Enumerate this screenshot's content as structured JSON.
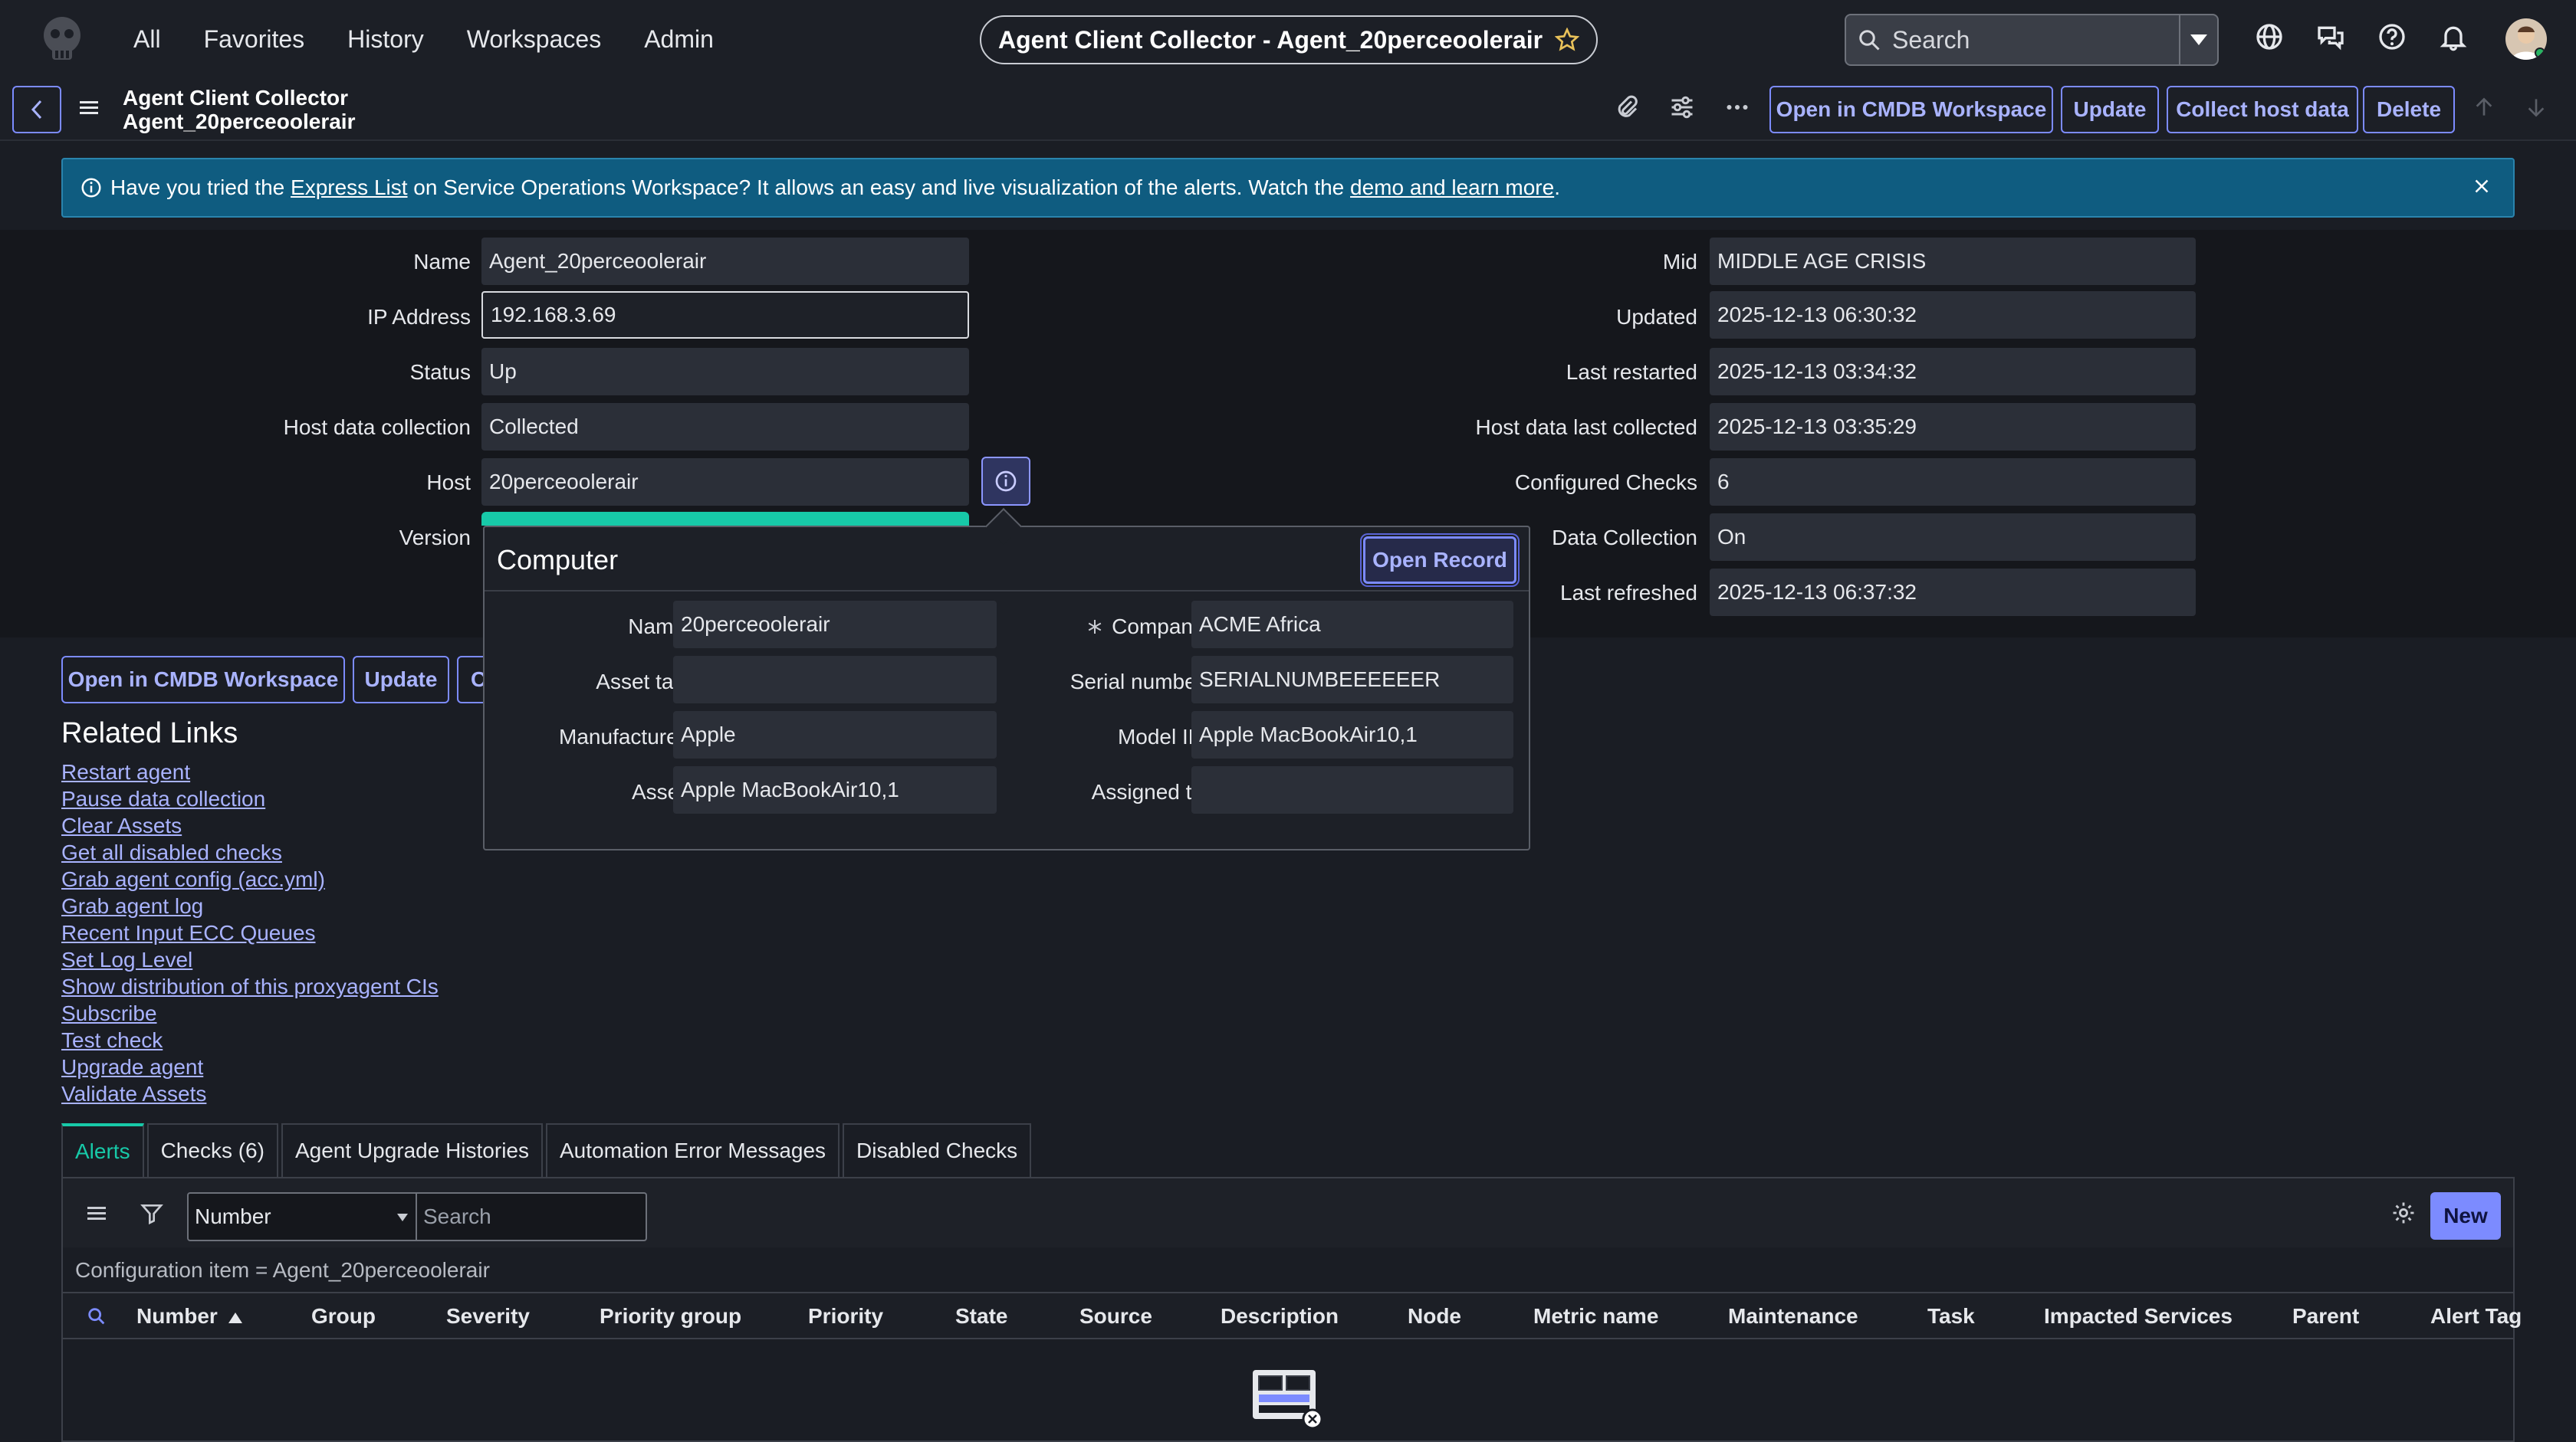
{
  "nav": {
    "links": [
      "All",
      "Favorites",
      "History",
      "Workspaces",
      "Admin"
    ],
    "title": "Agent Client Collector - Agent_20perceoolerair",
    "search_placeholder": "Search"
  },
  "record": {
    "title_line1": "Agent Client Collector",
    "title_line2": "Agent_20perceoolerair",
    "buttons": [
      "Open in CMDB Workspace",
      "Update",
      "Collect host data",
      "Delete"
    ]
  },
  "banner": {
    "prefix": "Have you tried the ",
    "link1": "Express List",
    "middle": " on Service Operations Workspace? It allows an easy and live visualization of the alerts. Watch the ",
    "link2": "demo and learn more",
    "suffix": "."
  },
  "form_left": [
    {
      "label": "Name",
      "value": "Agent_20perceoolerair"
    },
    {
      "label": "IP Address",
      "value": "192.168.3.69"
    },
    {
      "label": "Status",
      "value": "Up"
    },
    {
      "label": "Host data collection",
      "value": "Collected"
    },
    {
      "label": "Host",
      "value": "20perceoolerair"
    },
    {
      "label": "Version",
      "value": ""
    }
  ],
  "form_right": [
    {
      "label": "Mid",
      "value": "MIDDLE AGE CRISIS"
    },
    {
      "label": "Updated",
      "value": "2025-12-13 06:30:32"
    },
    {
      "label": "Last restarted",
      "value": "2025-12-13 03:34:32"
    },
    {
      "label": "Host data last collected",
      "value": "2025-12-13 03:35:29"
    },
    {
      "label": "Configured Checks",
      "value": "6"
    },
    {
      "label": "Data Collection",
      "value": "On"
    },
    {
      "label": "Last refreshed",
      "value": "2025-12-13 06:37:32"
    }
  ],
  "popup": {
    "title": "Computer",
    "open_label": "Open Record",
    "left": [
      {
        "label": "Name",
        "value": "20perceoolerair"
      },
      {
        "label": "Asset tag",
        "value": ""
      },
      {
        "label": "Manufacturer",
        "value": "Apple"
      },
      {
        "label": "Asset",
        "value": "Apple MacBookAir10,1"
      }
    ],
    "right": [
      {
        "label": "Company",
        "value": "ACME Africa"
      },
      {
        "label": "Serial number",
        "value": "SERIALNUMBEEEEEER"
      },
      {
        "label": "Model ID",
        "value": "Apple MacBookAir10,1"
      },
      {
        "label": "Assigned to",
        "value": ""
      }
    ]
  },
  "bottom_buttons": [
    "Open in CMDB Workspace",
    "Update",
    "C"
  ],
  "related": {
    "title": "Related Links",
    "links": [
      "Restart agent",
      "Pause data collection",
      "Clear Assets",
      "Get all disabled checks",
      "Grab agent config (acc.yml)",
      "Grab agent log",
      "Recent Input ECC Queues",
      "Set Log Level",
      "Show distribution of this proxyagent CIs",
      "Subscribe",
      "Test check",
      "Upgrade agent",
      "Validate Assets"
    ]
  },
  "tabs": [
    "Alerts",
    "Checks (6)",
    "Agent Upgrade Histories",
    "Automation Error Messages",
    "Disabled Checks"
  ],
  "list": {
    "select_value": "Number",
    "search_placeholder": "Search",
    "new_label": "New",
    "filter": "Configuration item = Agent_20perceoolerair",
    "columns": [
      "Number",
      "Group",
      "Severity",
      "Priority group",
      "Priority",
      "State",
      "Source",
      "Description",
      "Node",
      "Metric name",
      "Maintenance",
      "Task",
      "Impacted Services",
      "Parent",
      "Alert Tag"
    ]
  },
  "colors": {
    "accent": "#7c8bff",
    "teal": "#17c9a8",
    "banner": "#0f5c80"
  }
}
